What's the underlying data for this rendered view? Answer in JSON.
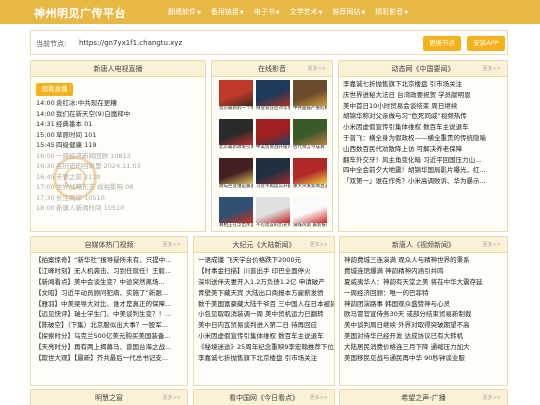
{
  "header": {
    "logo": "神州明见广传平台",
    "nav": [
      "翻墙软件",
      "备用链接",
      "电子书",
      "文学艺术",
      "推荐网站",
      "精彩影音"
    ]
  },
  "address_bar": {
    "label": "当前节点:",
    "url": "https://gn7yx1f1.changtu.xyz",
    "switch_label": "更换节点",
    "app_label": "安装APP"
  },
  "colors": {
    "accent": "#e8b845",
    "button": "#f6b21a",
    "panel_header": "#fbf1d6"
  },
  "sections": {
    "tv": {
      "title": "新唐人电视直播",
      "watch_label": "观看直播",
      "schedule": [
        {
          "time": "14:00",
          "title": "袁红冰:中共现在更糟"
        },
        {
          "time": "14:00",
          "title": "我们在新天空(9)白魔释中"
        },
        {
          "time": "14:31",
          "title": "经典番本 01"
        },
        {
          "time": "15:00",
          "title": "草原时间 101"
        },
        {
          "time": "15:45",
          "title": "四级健康 119"
        },
        {
          "time": "16:00",
          "title": "一周经济新闻回顾 10813"
        },
        {
          "time": "16:30",
          "title": "在历史的回声里 2024.11.03"
        },
        {
          "time": "16:45",
          "title": "天要之前 2119"
        },
        {
          "time": "17:00",
          "title": "世界战略东方 歧视影响 08"
        },
        {
          "time": "17:30",
          "title": "长江两岸 10510"
        },
        {
          "time": "18:00",
          "title": "新唐人新闻时间 10510"
        }
      ]
    },
    "video": {
      "title": "在线影音",
      "thumbs": [
        {
          "cap": "普京最新的一个举措"
        },
        {
          "cap": "拜登就任后对华策略"
        },
        {
          "cap": "中共面临严重危机"
        },
        {
          "cap": "北京最新政策引关注"
        },
        {
          "cap": "中美贸易战升级内幕"
        },
        {
          "cap": "古代预言今成真"
        },
        {
          "cap": "政坛巨变谁是赢家"
        },
        {
          "cap": "习近平再度公开露面"
        },
        {
          "cap": "重大突发新闻直击"
        },
        {
          "cap": "真相正在浮出水面"
        },
        {
          "cap": "不可思议的历史揭秘"
        },
        {
          "cap": "满城风雨 最新报道"
        }
      ]
    },
    "dongfang": {
      "title": "动态网《中国要闻》",
      "items": [
        "李嘉诚七折抛售旗下北京楼盘 引市场关注",
        "庆世界进秘大法日 台湾政要祝贺 学员献明恩",
        "美中首日10小时贸易会谈结束 周日继续",
        "胡锦华称对父亲做与习“危死同威”视频热传",
        "小米因虚假宣传引集体维权 数百车主说退车",
        "于普飞：横全身为假政权——横全重责的传统隐喻",
        "山西数百民代劝散降上访 可解决养老保障",
        "翻车外交牙！风主角变化暗 习近平回国压力山...",
        "四中全会前夕大地震！胡锦华国局影片曝光，红...",
        "「双第一」谁在作秀？小米高调败诉、华为暴示..."
      ]
    },
    "hot": {
      "title": "自媒体热门视频",
      "items": [
        "【拍案惊奇】“新华社”报导疑所未有、只提中...",
        "【江峰时刻】无人机袭击、习到任就任！王毅...",
        "【新闻看点】美中会谈生变？中途突然离场...",
        "【文昭】习近平动员顾问犯病、实施了”新跟...",
        "【雅羽】中美梁导大对比、谁才是真正的保障...",
        "【远见快评】瑞士学生门、中美谈判生变？！...",
        "【陈破空】（下集）北京服似出大事？一股军...",
        "【探索时分】乌克兰500亿美元购买美国装备...",
        "【天亮时分】再有两上揭募马、曾国台海之战...",
        "【欺世大观】【最新】芥共最后一代总书记支..."
      ]
    },
    "dajiyuan": {
      "title": "大纪元《大陆新闻》",
      "items": [
        "一语成谶 飞天学台价格跌下2000元",
        "【时事金扫描】川普出手 印巴全面停火",
        "深圳送伴夫妻开入1.2万负债1.2亿 申请破产",
        "青壁美下藏天宾 大陆出口商报本方雇薪发愤",
        "数千美国富豪藏大陆千爷百 三中国人在日本被捕",
        "小包见取取消装调一周 美中贸机运力已翻转",
        "美中日内瓦贸易谈判进入第二日 待再回应",
        "小米因虚假宣传引集体维权 数百车主说退车",
        "《秘境迷途》25周年纪念重映9李宏翰推荐下位",
        "李嘉诚七折抛售旗下北京楼盘 引市场关注"
      ]
    },
    "ntd_video": {
      "title": "新唐人《视频新闻》",
      "items": [
        "神韵费城三连演满 观众人与精神世界的秉系",
        "费城连馆爆满 神韵精神内涵引共鸣",
        "夏威夷华人：神韵有天堂之美 将在中华大震存延",
        "一周经济回顾：唯一的巴菲特",
        "神韵团演路事 韩国观众盛赞神与心灵",
        "欧马冒官宣侍务30天 或部分结束贸易新制裁",
        "美中谈判周日继续 外界对取得突破期望不高",
        "美国对待华已经开发 达成协议已有大转机",
        "大陆居民消费价格连三月下降 通缩压力加大",
        "美国移民见战与通民再中华 90秒钟谈业服"
      ]
    },
    "bottom": [
      {
        "title": "明慧之窗"
      },
      {
        "title": "看中国网《今日看点》"
      },
      {
        "title": "希望之声-广播"
      }
    ],
    "more": "更多>>"
  }
}
